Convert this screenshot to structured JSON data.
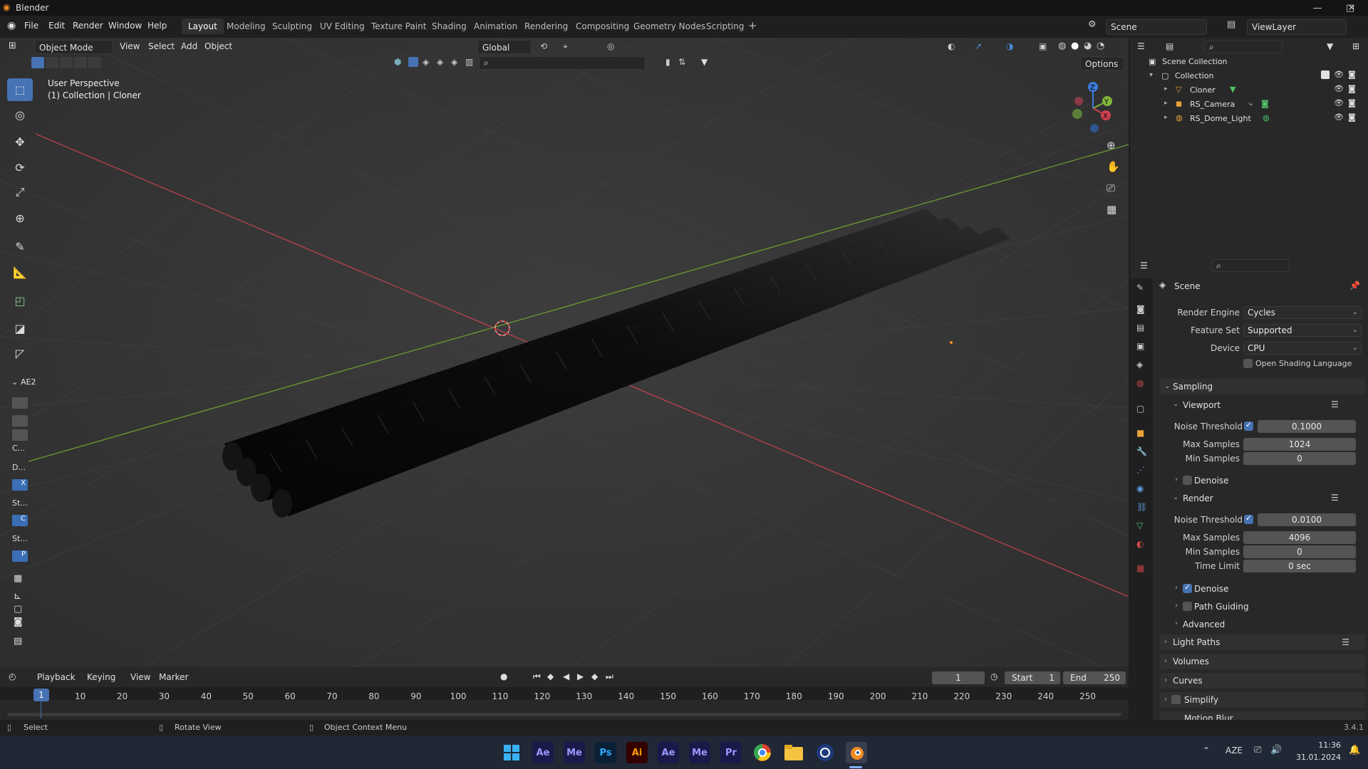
{
  "window": {
    "title": "Blender",
    "minimize": "—",
    "maximize": "□",
    "close": "✕"
  },
  "menu": {
    "file": "File",
    "edit": "Edit",
    "render": "Render",
    "window": "Window",
    "help": "Help"
  },
  "workspaces": [
    "Layout",
    "Modeling",
    "Sculpting",
    "UV Editing",
    "Texture Paint",
    "Shading",
    "Animation",
    "Rendering",
    "Compositing",
    "Geometry Nodes",
    "Scripting"
  ],
  "scene_name": "Scene",
  "view_layer": "ViewLayer",
  "viewport_header": {
    "mode": "Object Mode",
    "view": "View",
    "select": "Select",
    "add": "Add",
    "object": "Object",
    "orientation": "Global",
    "options": "Options"
  },
  "viewport_overlay": {
    "perspective": "User Perspective",
    "context": "(1) Collection | Cloner",
    "side_panel_title": "AE2",
    "side_items": [
      "C...",
      "D...",
      "X",
      "St...",
      "C",
      "St...",
      "P"
    ]
  },
  "outliner": {
    "root": "Scene Collection",
    "collection": "Collection",
    "items": [
      "Cloner",
      "RS_Camera",
      "RS_Dome_Light"
    ]
  },
  "properties": {
    "context": "Scene",
    "render_engine_label": "Render Engine",
    "render_engine": "Cycles",
    "feature_set_label": "Feature Set",
    "feature_set": "Supported",
    "device_label": "Device",
    "device": "CPU",
    "osl_label": "Open Shading Language",
    "sampling": "Sampling",
    "viewport": "Viewport",
    "vp_noise_label": "Noise Threshold",
    "vp_noise": "0.1000",
    "vp_max_label": "Max Samples",
    "vp_max": "1024",
    "vp_min_label": "Min Samples",
    "vp_min": "0",
    "vp_denoise": "Denoise",
    "render": "Render",
    "r_noise_label": "Noise Threshold",
    "r_noise": "0.0100",
    "r_max_label": "Max Samples",
    "r_max": "4096",
    "r_min_label": "Min Samples",
    "r_min": "0",
    "r_time_label": "Time Limit",
    "r_time": "0 sec",
    "r_denoise": "Denoise",
    "path_guiding": "Path Guiding",
    "advanced": "Advanced",
    "light_paths": "Light Paths",
    "volumes": "Volumes",
    "curves": "Curves",
    "simplify": "Simplify",
    "motion_blur": "Motion Blur"
  },
  "timeline": {
    "playback": "Playback",
    "keying": "Keying",
    "view": "View",
    "marker": "Marker",
    "current_frame": "1",
    "start_label": "Start",
    "start": "1",
    "end_label": "End",
    "end": "250",
    "ruler": [
      "10",
      "20",
      "30",
      "40",
      "50",
      "60",
      "70",
      "80",
      "90",
      "100",
      "110",
      "120",
      "130",
      "140",
      "150",
      "160",
      "170",
      "180",
      "190",
      "200",
      "210",
      "220",
      "230",
      "240",
      "250"
    ],
    "playhead": "1"
  },
  "statusbar": {
    "select": "Select",
    "rotate": "Rotate View",
    "context_menu": "Object Context Menu",
    "version": "3.4.1"
  },
  "taskbar": {
    "apps": [
      "Ae",
      "Me",
      "Ps",
      "Ai",
      "Ae",
      "Me",
      "Pr"
    ],
    "language": "AZE",
    "time": "11:36",
    "date": "31.01.2024"
  },
  "colors": {
    "accent": "#4772b3",
    "x_axis": "#d0404f",
    "y_axis": "#7fb53a",
    "z_axis": "#3b7bd9"
  }
}
